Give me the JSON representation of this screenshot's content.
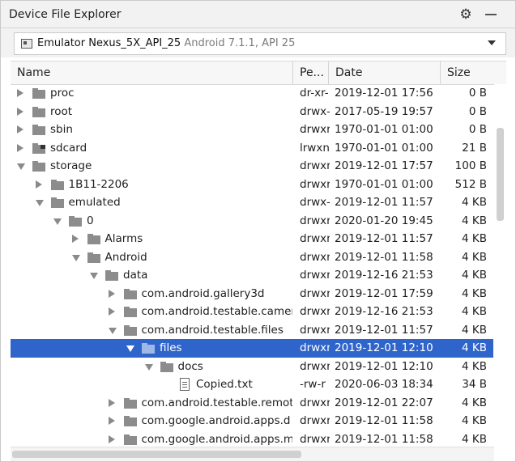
{
  "window": {
    "title": "Device File Explorer"
  },
  "toolbar": {
    "settings_icon": "gear-icon",
    "minimize_icon": "minimize-icon"
  },
  "device": {
    "name": "Emulator Nexus_5X_API_25",
    "details": "Android 7.1.1, API 25",
    "icon": "emulator-icon"
  },
  "columns": {
    "name": "Name",
    "permissions": "Pe...",
    "date": "Date",
    "size": "Size"
  },
  "rows": [
    {
      "name": "proc",
      "perm": "dr-xr-",
      "date": "2019-12-01 17:56",
      "size": "0 B",
      "depth": 0,
      "type": "folder",
      "state": "collapsed"
    },
    {
      "name": "root",
      "perm": "drwx-",
      "date": "2017-05-19 19:57",
      "size": "0 B",
      "depth": 0,
      "type": "folder",
      "state": "collapsed"
    },
    {
      "name": "sbin",
      "perm": "drwxr",
      "date": "1970-01-01 01:00",
      "size": "0 B",
      "depth": 0,
      "type": "folder",
      "state": "collapsed"
    },
    {
      "name": "sdcard",
      "perm": "lrwxn",
      "date": "1970-01-01 01:00",
      "size": "21 B",
      "depth": 0,
      "type": "link",
      "state": "collapsed"
    },
    {
      "name": "storage",
      "perm": "drwxr",
      "date": "2019-12-01 17:57",
      "size": "100 B",
      "depth": 0,
      "type": "folder",
      "state": "expanded"
    },
    {
      "name": "1B11-2206",
      "perm": "drwxr",
      "date": "1970-01-01 01:00",
      "size": "512 B",
      "depth": 1,
      "type": "folder",
      "state": "collapsed"
    },
    {
      "name": "emulated",
      "perm": "drwx-",
      "date": "2019-12-01 11:57",
      "size": "4 KB",
      "depth": 1,
      "type": "folder",
      "state": "expanded"
    },
    {
      "name": "0",
      "perm": "drwxr",
      "date": "2020-01-20 19:45",
      "size": "4 KB",
      "depth": 2,
      "type": "folder",
      "state": "expanded"
    },
    {
      "name": "Alarms",
      "perm": "drwxr",
      "date": "2019-12-01 11:57",
      "size": "4 KB",
      "depth": 3,
      "type": "folder",
      "state": "collapsed"
    },
    {
      "name": "Android",
      "perm": "drwxr",
      "date": "2019-12-01 11:58",
      "size": "4 KB",
      "depth": 3,
      "type": "folder",
      "state": "expanded"
    },
    {
      "name": "data",
      "perm": "drwxr",
      "date": "2019-12-16 21:53",
      "size": "4 KB",
      "depth": 4,
      "type": "folder",
      "state": "expanded"
    },
    {
      "name": "com.android.gallery3d",
      "perm": "drwxr",
      "date": "2019-12-01 17:59",
      "size": "4 KB",
      "depth": 5,
      "type": "folder",
      "state": "collapsed"
    },
    {
      "name": "com.android.testable.camer",
      "perm": "drwxr",
      "date": "2019-12-16 21:53",
      "size": "4 KB",
      "depth": 5,
      "type": "folder",
      "state": "collapsed"
    },
    {
      "name": "com.android.testable.files",
      "perm": "drwxr",
      "date": "2019-12-01 11:57",
      "size": "4 KB",
      "depth": 5,
      "type": "folder",
      "state": "expanded"
    },
    {
      "name": "files",
      "perm": "drwxr",
      "date": "2019-12-01 12:10",
      "size": "4 KB",
      "depth": 6,
      "type": "folder",
      "state": "expanded",
      "selected": true
    },
    {
      "name": "docs",
      "perm": "drwxr",
      "date": "2019-12-01 12:10",
      "size": "4 KB",
      "depth": 7,
      "type": "folder",
      "state": "expanded"
    },
    {
      "name": "Copied.txt",
      "perm": "-rw-r",
      "date": "2020-06-03 18:34",
      "size": "34 B",
      "depth": 8,
      "type": "file",
      "state": "none"
    },
    {
      "name": "com.android.testable.remot",
      "perm": "drwxr",
      "date": "2019-12-01 22:07",
      "size": "4 KB",
      "depth": 5,
      "type": "folder",
      "state": "collapsed"
    },
    {
      "name": "com.google.android.apps.d",
      "perm": "drwxr",
      "date": "2019-12-01 11:58",
      "size": "4 KB",
      "depth": 5,
      "type": "folder",
      "state": "collapsed"
    },
    {
      "name": "com.google.android.apps.m",
      "perm": "drwxr",
      "date": "2019-12-01 11:58",
      "size": "4 KB",
      "depth": 5,
      "type": "folder",
      "state": "collapsed"
    }
  ]
}
